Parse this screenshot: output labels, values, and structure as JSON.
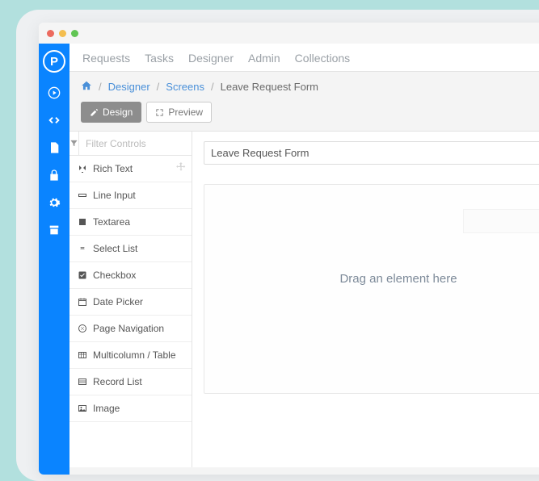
{
  "topnav": {
    "items": [
      "Requests",
      "Tasks",
      "Designer",
      "Admin",
      "Collections"
    ]
  },
  "sidebar": {
    "logo_letter": "P"
  },
  "breadcrumb": {
    "link1": "Designer",
    "link2": "Screens",
    "current": "Leave Request Form"
  },
  "tabs": {
    "design": "Design",
    "preview": "Preview"
  },
  "filter": {
    "placeholder": "Filter Controls"
  },
  "controls": [
    {
      "label": "Rich Text",
      "icon": "richtext",
      "dragging": true
    },
    {
      "label": "Line Input",
      "icon": "lineinput"
    },
    {
      "label": "Textarea",
      "icon": "textarea"
    },
    {
      "label": "Select List",
      "icon": "select"
    },
    {
      "label": "Checkbox",
      "icon": "checkbox"
    },
    {
      "label": "Date Picker",
      "icon": "datepicker"
    },
    {
      "label": "Page Navigation",
      "icon": "pagenav"
    },
    {
      "label": "Multicolumn / Table",
      "icon": "table"
    },
    {
      "label": "Record List",
      "icon": "recordlist"
    },
    {
      "label": "Image",
      "icon": "image"
    }
  ],
  "canvas": {
    "form_title": "Leave Request Form",
    "drag_hint": "Drag an element here"
  }
}
